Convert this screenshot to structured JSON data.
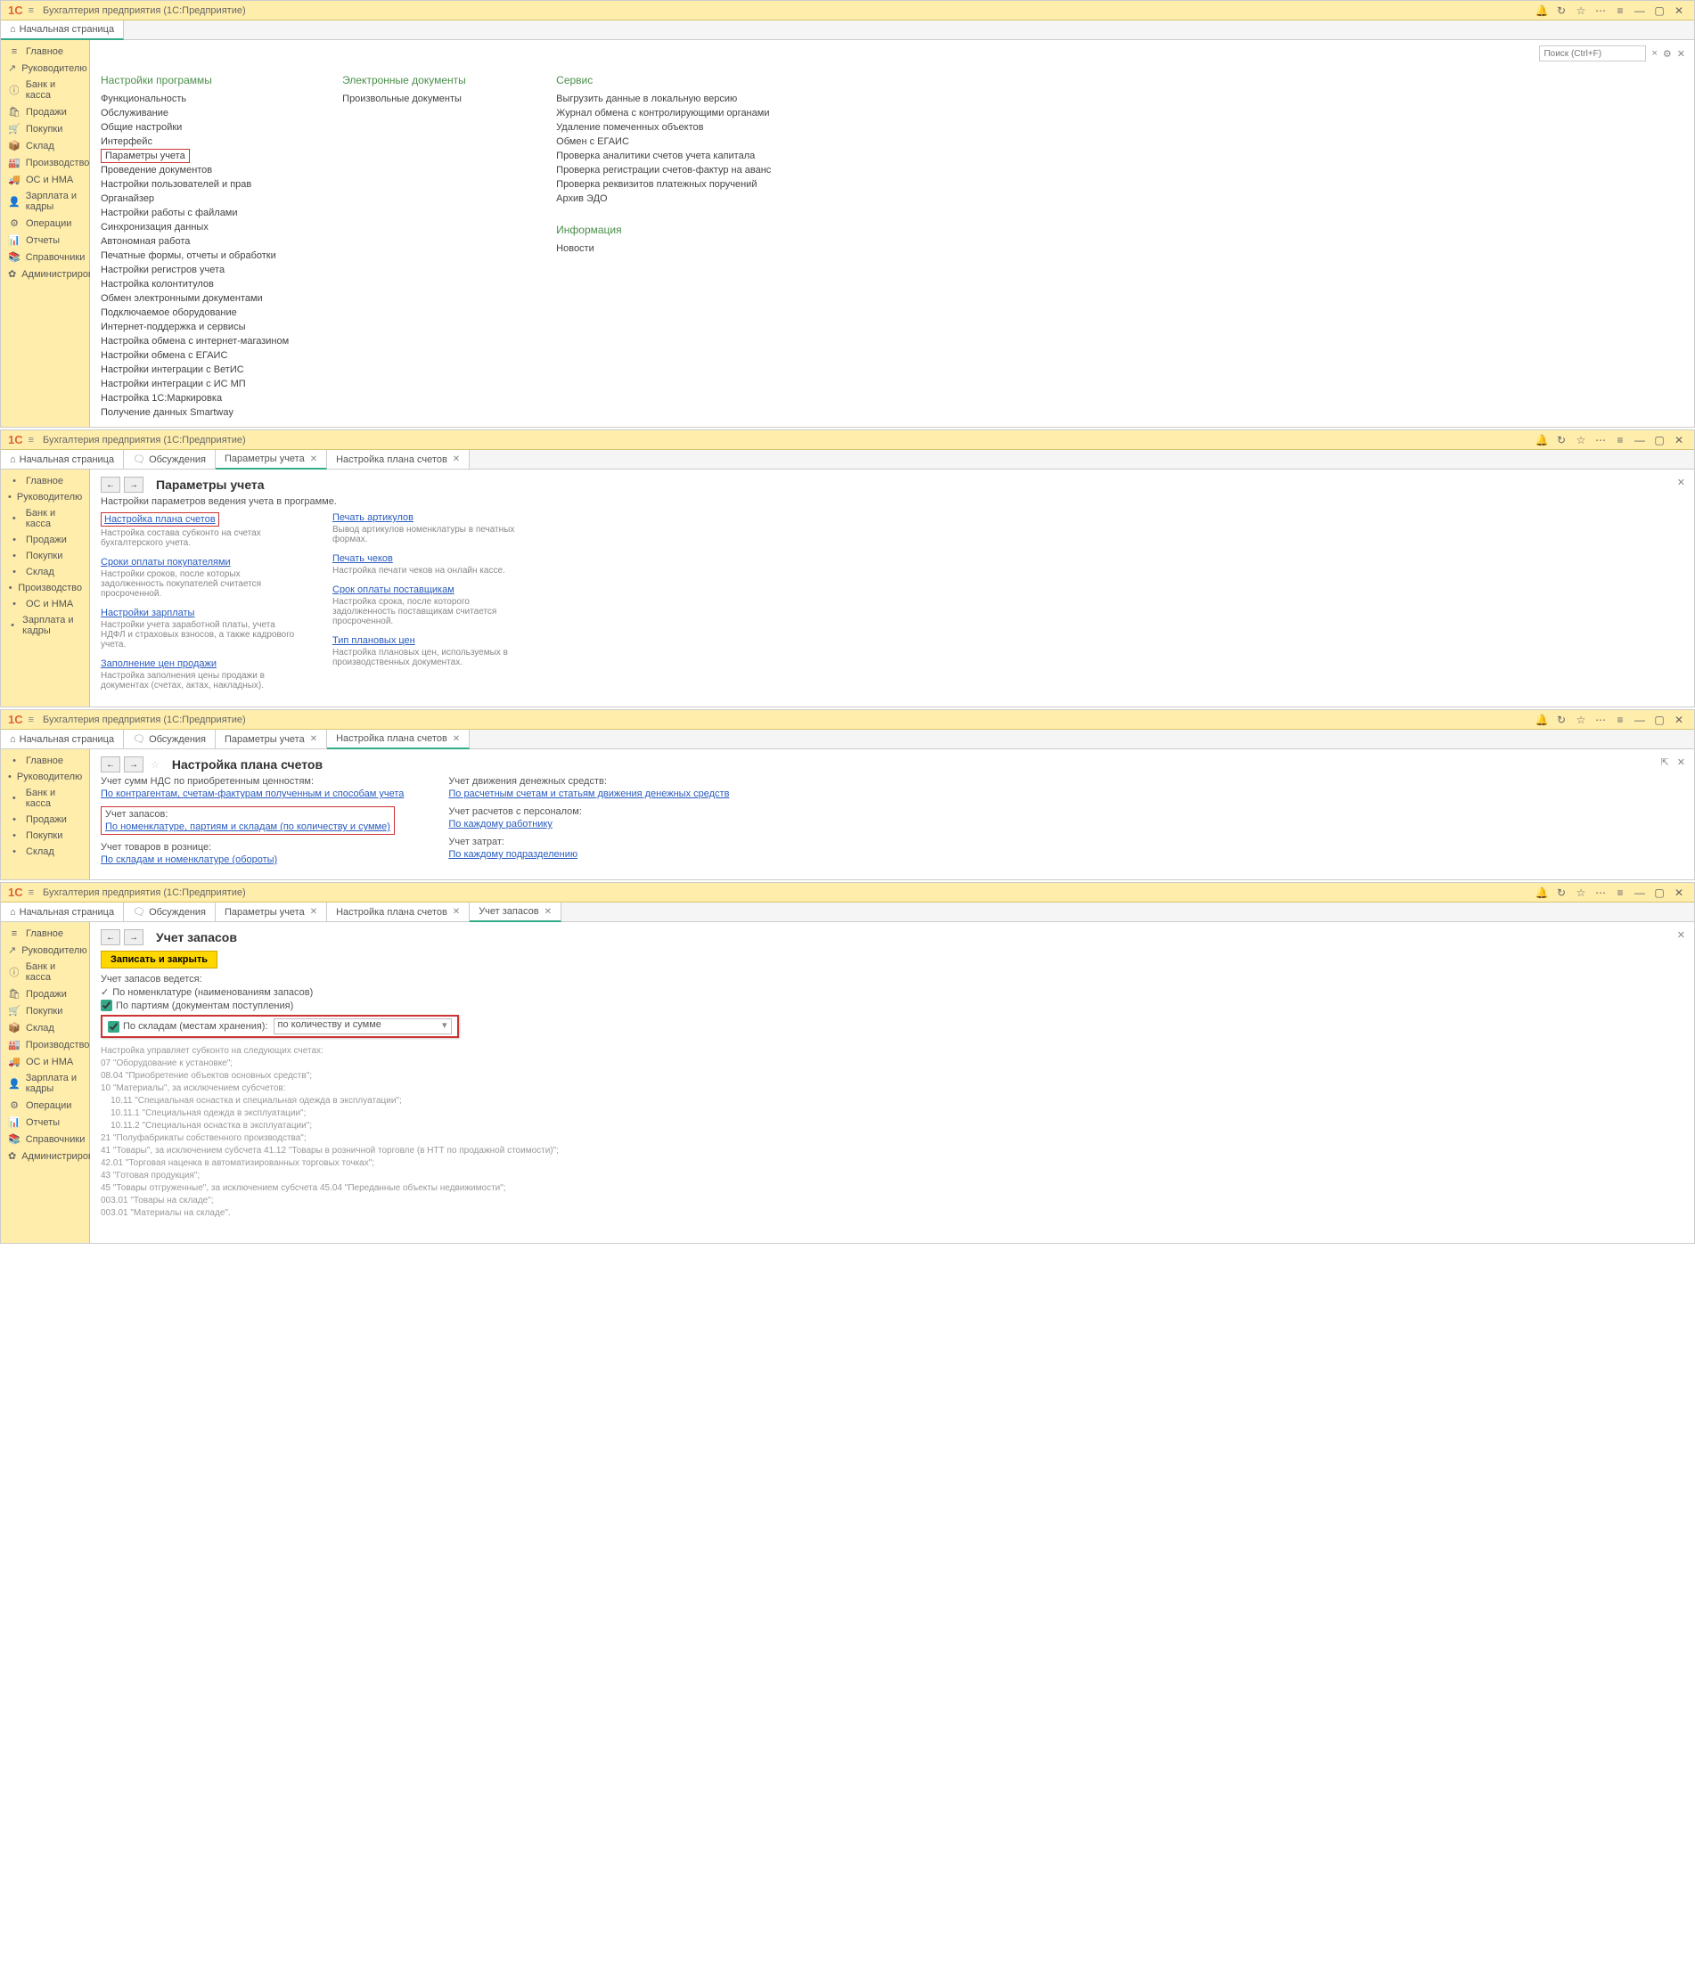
{
  "app_title": "Бухгалтерия предприятия  (1С:Предприятие)",
  "logo": "1C",
  "search_placeholder": "Поиск (Ctrl+F)",
  "sidebar": {
    "items": [
      {
        "icon": "≡",
        "label": "Главное"
      },
      {
        "icon": "↗",
        "label": "Руководителю"
      },
      {
        "icon": "ⓘ",
        "label": "Банк и касса"
      },
      {
        "icon": "🛍",
        "label": "Продажи"
      },
      {
        "icon": "🛒",
        "label": "Покупки"
      },
      {
        "icon": "📦",
        "label": "Склад"
      },
      {
        "icon": "🏭",
        "label": "Производство"
      },
      {
        "icon": "🚚",
        "label": "ОС и НМА"
      },
      {
        "icon": "👤",
        "label": "Зарплата и кадры"
      },
      {
        "icon": "⚙",
        "label": "Операции"
      },
      {
        "icon": "📊",
        "label": "Отчеты"
      },
      {
        "icon": "📚",
        "label": "Справочники"
      },
      {
        "icon": "✿",
        "label": "Администрирование"
      }
    ]
  },
  "sidebar_short": [
    "Главное",
    "Руководителю",
    "Банк и касса",
    "Продажи",
    "Покупки",
    "Склад",
    "Производство",
    "ОС и НМА",
    "Зарплата и кадры"
  ],
  "sidebar_short2": [
    "Главное",
    "Руководителю",
    "Банк и касса",
    "Продажи",
    "Покупки",
    "Склад"
  ],
  "tabs": {
    "start": "Начальная страница",
    "discuss": "Обсуждения",
    "params": "Параметры учета",
    "plan": "Настройка плана счетов",
    "inv": "Учет запасов"
  },
  "admin_page": {
    "col1_header": "Настройки программы",
    "col1": [
      "Функциональность",
      "Обслуживание",
      "Общие настройки",
      "Интерфейс",
      "Параметры учета",
      "Проведение документов",
      "Настройки пользователей и прав",
      "Органайзер",
      "Настройки работы с файлами",
      "Синхронизация данных",
      "Автономная работа",
      "Печатные формы, отчеты и обработки",
      "Настройки регистров учета",
      "Настройка колонтитулов",
      "Обмен электронными документами",
      "Подключаемое оборудование",
      "Интернет-поддержка и сервисы",
      "Настройка обмена с интернет-магазином",
      "Настройки обмена с ЕГАИС",
      "Настройки интеграции с ВетИС",
      "Настройки интеграции с ИС МП",
      "Настройка 1С:Маркировка",
      "Получение данных Smartway"
    ],
    "col2_header": "Электронные документы",
    "col2": [
      "Произвольные документы"
    ],
    "col3_header": "Сервис",
    "col3": [
      "Выгрузить данные в локальную версию",
      "Журнал обмена с контролирующими органами",
      "Удаление помеченных объектов",
      "Обмен с ЕГАИС",
      "Проверка аналитики счетов учета капитала",
      "Проверка регистрации счетов-фактур на аванс",
      "Проверка реквизитов платежных поручений",
      "Архив ЭДО"
    ],
    "col4_header": "Информация",
    "col4": [
      "Новости"
    ]
  },
  "params_page": {
    "title": "Параметры учета",
    "subtitle": "Настройки параметров ведения учета в программе.",
    "left": [
      {
        "link": "Настройка плана счетов",
        "desc": "Настройка состава субконто на счетах бухгалтерского учета.",
        "boxed": true
      },
      {
        "link": "Сроки оплаты покупателями",
        "desc": "Настройки сроков, после которых задолженность покупателей считается просроченной."
      },
      {
        "link": "Настройки зарплаты",
        "desc": "Настройки учета заработной платы, учета НДФЛ и страховых взносов, а также кадрового учета."
      },
      {
        "link": "Заполнение цен продажи",
        "desc": "Настройка заполнения цены продажи в документах (счетах, актах, накладных)."
      }
    ],
    "right": [
      {
        "link": "Печать артикулов",
        "desc": "Вывод артикулов номенклатуры в печатных формах."
      },
      {
        "link": "Печать чеков",
        "desc": "Настройка печати чеков на онлайн кассе."
      },
      {
        "link": "Срок оплаты поставщикам",
        "desc": "Настройка срока, после которого задолженность поставщикам считается просроченной."
      },
      {
        "link": "Тип плановых цен",
        "desc": "Настройка плановых цен, используемых в производственных документах."
      }
    ]
  },
  "plan_page": {
    "title": "Настройка плана счетов",
    "rows": [
      {
        "label": "Учет сумм НДС по приобретенным ценностям:",
        "link": "По контрагентам, счетам-фактурам полученным и способам учета",
        "rlabel": "Учет движения денежных средств:",
        "rlink": "По расчетным счетам и статьям движения денежных средств"
      },
      {
        "label": "Учет запасов:",
        "link": "По номенклатуре, партиям и складам (по количеству и сумме)",
        "boxed": true,
        "rlabel": "Учет расчетов с персоналом:",
        "rlink": "По каждому работнику"
      },
      {
        "label": "Учет товаров в рознице:",
        "link": "По складам и номенклатуре (обороты)",
        "rlabel": "Учет затрат:",
        "rlink": "По каждому подразделению"
      }
    ]
  },
  "inv_page": {
    "title": "Учет запасов",
    "save_btn": "Записать и закрыть",
    "header_text": "Учет запасов ведется:",
    "checks": [
      {
        "label": "По номенклатуре (наименованиям запасов)",
        "checked": true,
        "readonly": true
      },
      {
        "label": "По партиям (документам поступления)",
        "checked": true
      },
      {
        "label": "По складам (местам хранения):",
        "checked": true,
        "boxed": true
      }
    ],
    "dropdown_value": "по количеству и сумме",
    "footer_text": "Настройка управляет субконто на следующих счетах:\n07 \"Оборудование к установке\";\n08.04 \"Приобретение объектов основных средств\";\n10 \"Материалы\", за исключением субсчетов:\n    10.11 \"Специальная оснастка и специальная одежда в эксплуатации\";\n    10.11.1 \"Специальная одежда в эксплуатации\";\n    10.11.2 \"Специальная оснастка в эксплуатации\";\n21 \"Полуфабрикаты собственного производства\";\n41 \"Товары\", за исключением субсчета 41.12 \"Товары в розничной торговле (в НТТ по продажной стоимости)\";\n42.01 \"Торговая наценка в автоматизированных торговых точках\";\n43 \"Готовая продукция\";\n45 \"Товары отгруженные\", за исключением субсчета 45.04 \"Переданные объекты недвижимости\";\n003.01 \"Товары на складе\";\n003.01 \"Материалы на складе\"."
  }
}
